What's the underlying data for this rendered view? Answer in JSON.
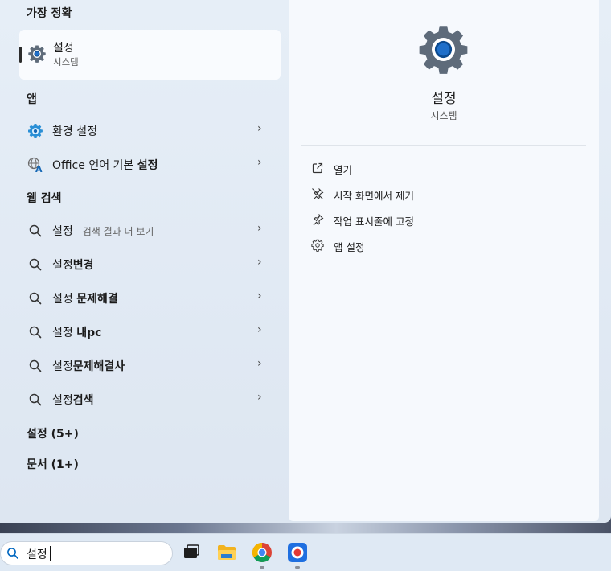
{
  "best_match": {
    "section_title": "가장 정확",
    "name": "설정",
    "subtitle": "시스템",
    "icon": "settings-gear-icon"
  },
  "apps": {
    "section_title": "앱",
    "items": [
      {
        "label": "환경 설정",
        "icon": "control-panel-icon"
      },
      {
        "label_prefix": "Office 언어 기본 ",
        "label_bold": "설정",
        "icon": "office-language-icon"
      }
    ]
  },
  "web_search": {
    "section_title": "웹 검색",
    "items": [
      {
        "label": "설정",
        "hint": " - 검색 결과 더 보기"
      },
      {
        "prefix": "설정",
        "bold": "변경"
      },
      {
        "prefix": "설정 ",
        "bold": "문제해결"
      },
      {
        "prefix": "설정 ",
        "bold": "내pc"
      },
      {
        "prefix": "설정",
        "bold": "문제해결사"
      },
      {
        "prefix": "설정",
        "bold": "검색"
      }
    ]
  },
  "more_sections": [
    {
      "label": "설정 (5+)"
    },
    {
      "label": "문서 (1+)"
    }
  ],
  "detail": {
    "name": "설정",
    "subtitle": "시스템",
    "actions": [
      {
        "label": "열기",
        "icon": "open-external-icon"
      },
      {
        "label": "시작 화면에서 제거",
        "icon": "unpin-icon"
      },
      {
        "label": "작업 표시줄에 고정",
        "icon": "pin-icon"
      },
      {
        "label": "앱 설정",
        "icon": "gear-icon"
      }
    ]
  },
  "taskbar": {
    "search_value": "설정",
    "apps": [
      "task-view-icon",
      "file-explorer-icon",
      "chrome-icon",
      "screen-recorder-icon"
    ]
  },
  "colors": {
    "accent": "#0067c0",
    "gear": "#5e6b7a"
  }
}
